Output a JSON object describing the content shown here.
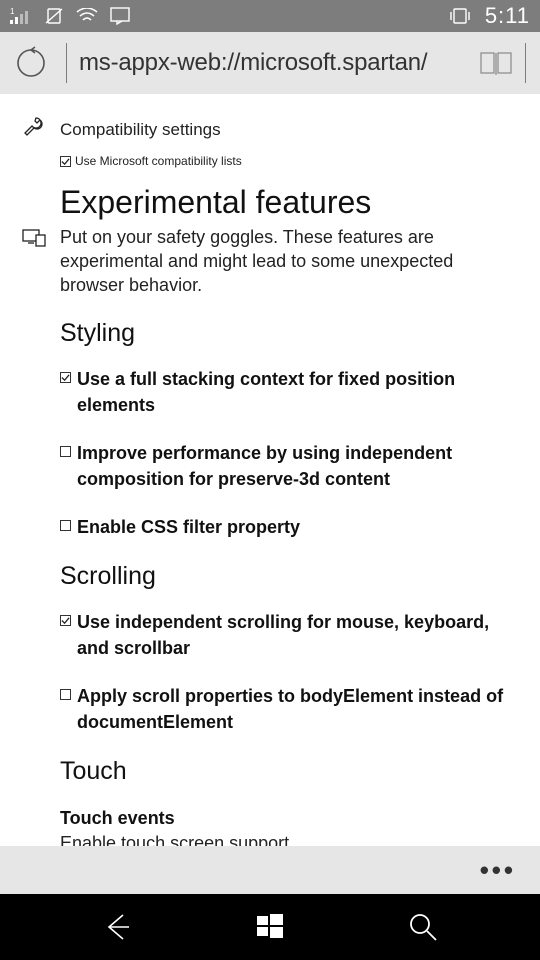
{
  "status_bar": {
    "sim": "1",
    "time": "5:11"
  },
  "url_bar": {
    "url": "ms-appx-web://microsoft.spartan/"
  },
  "compatibility": {
    "title": "Compatibility settings",
    "checkbox_label": "Use Microsoft compatibility lists",
    "checkbox_checked": true
  },
  "experimental": {
    "heading": "Experimental features",
    "description": "Put on your safety goggles. These features are experimental and might lead to some unexpected browser behavior."
  },
  "sections": {
    "styling": {
      "heading": "Styling",
      "options": [
        {
          "label": "Use a full stacking context for fixed position elements",
          "checked": true
        },
        {
          "label": "Improve performance by using independent composition for preserve-3d content",
          "checked": false
        },
        {
          "label": "Enable CSS filter property",
          "checked": false
        }
      ]
    },
    "scrolling": {
      "heading": "Scrolling",
      "options": [
        {
          "label": "Use independent scrolling for mouse, keyboard, and scrollbar",
          "checked": true
        },
        {
          "label": "Apply scroll properties to bodyElement instead of documentElement",
          "checked": false
        }
      ]
    },
    "touch": {
      "heading": "Touch",
      "subheading": "Touch events",
      "description": "Enable touch screen support"
    }
  },
  "app_bar": {
    "ellipsis": "•••"
  }
}
